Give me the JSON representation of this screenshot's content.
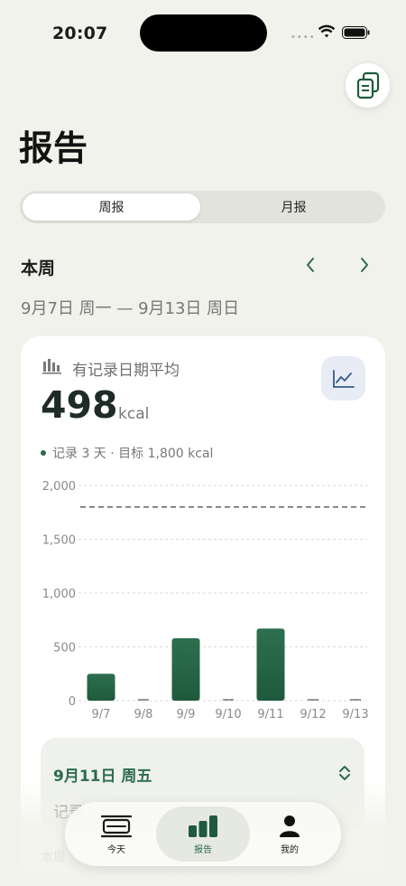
{
  "status_bar": {
    "time": "20:07"
  },
  "header": {
    "title": "报告"
  },
  "segment": {
    "weekly": "周报",
    "monthly": "月报"
  },
  "period": {
    "label": "本周",
    "range": "9月7日 周一 — 9月13日 周日"
  },
  "summary_card": {
    "label": "有记录日期平均",
    "value": "498",
    "unit": "kcal",
    "meta": "记录 3 天 · 目标 1,800 kcal"
  },
  "chart_data": {
    "type": "bar",
    "categories": [
      "9/7",
      "9/8",
      "9/9",
      "9/10",
      "9/11",
      "9/12",
      "9/13"
    ],
    "values": [
      250,
      0,
      580,
      0,
      670,
      0,
      0
    ],
    "ylim": [
      0,
      2000
    ],
    "yticks": [
      0,
      500,
      1000,
      1500,
      2000
    ],
    "ytick_labels": [
      "0",
      "500",
      "1,000",
      "1,500",
      "2,000"
    ],
    "goal_line": 1800,
    "grid": true,
    "colors": {
      "bar_top": "#2d6f4e",
      "bar_bottom": "#1f5a3d",
      "goal": "#555555",
      "grid": "#d9d9d9"
    }
  },
  "detail": {
    "date": "9月11日 周五",
    "record_label": "记录"
  },
  "summary_text": "本周",
  "tabbar": {
    "today": "今天",
    "report": "报告",
    "me": "我的"
  },
  "colors": {
    "accent": "#2a6b4a",
    "background": "#f2f2ec"
  }
}
